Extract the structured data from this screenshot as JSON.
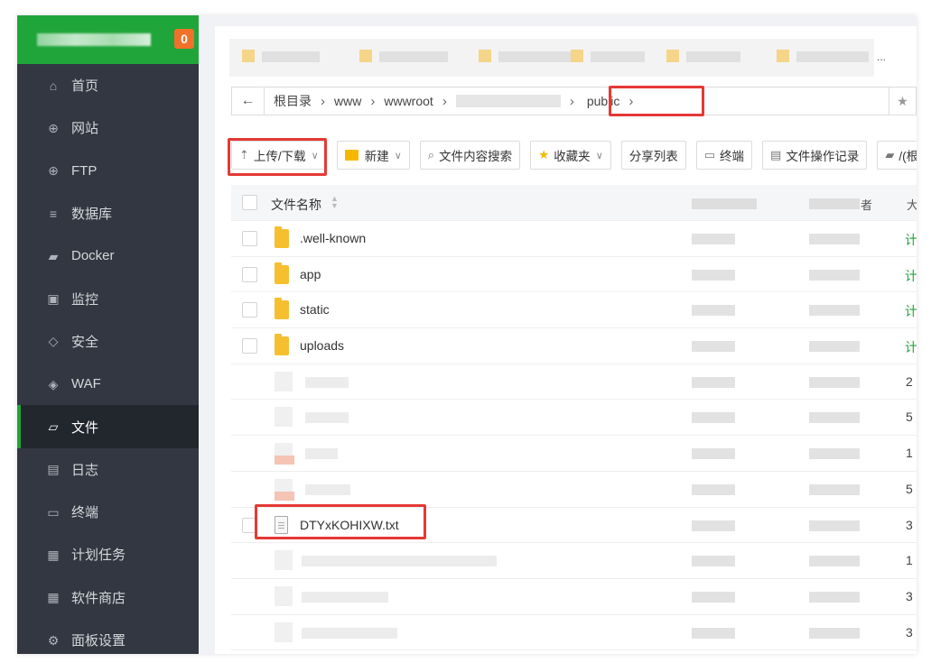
{
  "sidebar": {
    "badge": "0",
    "items": [
      {
        "label": "首页",
        "icon": "home-icon",
        "glyph": "⌂"
      },
      {
        "label": "网站",
        "icon": "globe-icon",
        "glyph": "⊕"
      },
      {
        "label": "FTP",
        "icon": "ftp-icon",
        "glyph": "⊕"
      },
      {
        "label": "数据库",
        "icon": "database-icon",
        "glyph": "≡"
      },
      {
        "label": "Docker",
        "icon": "docker-icon",
        "glyph": "▰"
      },
      {
        "label": "监控",
        "icon": "monitor-icon",
        "glyph": "▣"
      },
      {
        "label": "安全",
        "icon": "shield-icon",
        "glyph": "◇"
      },
      {
        "label": "WAF",
        "icon": "waf-icon",
        "glyph": "◈"
      },
      {
        "label": "文件",
        "icon": "folder-icon",
        "glyph": "▱"
      },
      {
        "label": "日志",
        "icon": "log-icon",
        "glyph": "▤"
      },
      {
        "label": "终端",
        "icon": "terminal-icon",
        "glyph": "▭"
      },
      {
        "label": "计划任务",
        "icon": "calendar-icon",
        "glyph": "▦"
      },
      {
        "label": "软件商店",
        "icon": "apps-icon",
        "glyph": "▦"
      },
      {
        "label": "面板设置",
        "icon": "gear-icon",
        "glyph": "⚙"
      }
    ]
  },
  "tabs": {
    "more": "..."
  },
  "breadcrumb": {
    "back": "←",
    "root": "根目录",
    "p1": "www",
    "p2": "wwwroot",
    "current": "public",
    "sep": "›"
  },
  "toolbar": {
    "upload": "上传/下载",
    "new": "新建",
    "search": "文件内容搜索",
    "favorites": "收藏夹",
    "share": "分享列表",
    "terminal": "终端",
    "oplog": "文件操作记录",
    "disk": "/(根目..."
  },
  "table": {
    "header_name": "文件名称",
    "header_owner_suffix": "者",
    "header_size_prefix": "大",
    "folders": [
      {
        "name": ".well-known",
        "perm": "计"
      },
      {
        "name": "app",
        "perm": "计"
      },
      {
        "name": "static",
        "perm": "计"
      },
      {
        "name": "uploads",
        "perm": "计"
      }
    ],
    "row_nums": [
      "2",
      "5",
      "1",
      "5"
    ],
    "file": {
      "name": "DTYxKOHIXW.txt",
      "num": "3"
    },
    "tail_nums": [
      "1",
      "3",
      "3"
    ]
  }
}
